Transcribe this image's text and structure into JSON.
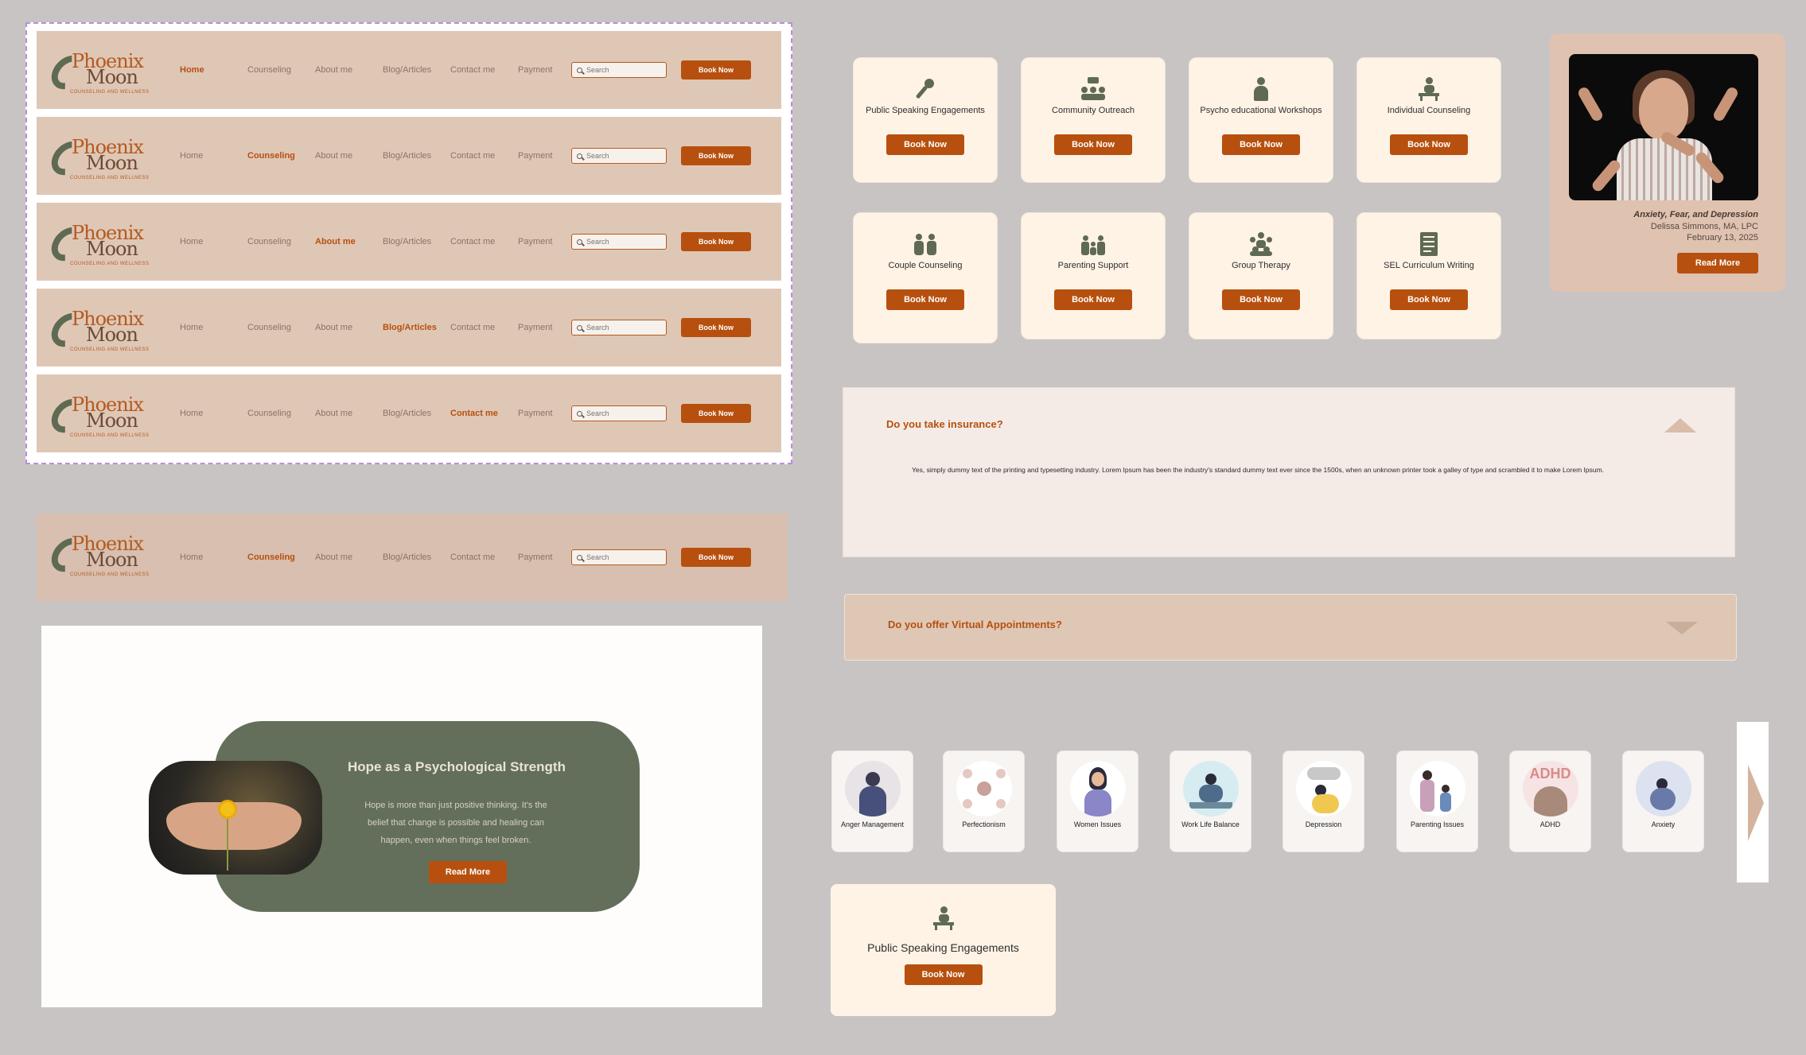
{
  "nav": {
    "logo_text_top": "Phoenix",
    "logo_text_bottom": "Moon",
    "logo_tagline": "COUNSELING AND WELLNESS",
    "links": [
      "Home",
      "Counseling",
      "About me",
      "Blog/Articles",
      "Contact me",
      "Payment"
    ],
    "search_placeholder": "Search",
    "book_label": "Book Now",
    "variants_active": [
      "Home",
      "Counseling",
      "About me",
      "Blog/Articles",
      "Contact me"
    ],
    "standalone_active": "Counseling"
  },
  "hope": {
    "title": "Hope as a Psychological Strength",
    "text": "Hope is more than just positive thinking. It's the belief that change is possible and healing can happen, even when things feel broken.",
    "button": "Read More"
  },
  "services": [
    {
      "label": "Public Speaking Engagements",
      "icon": "microphone-icon",
      "button": "Book Now"
    },
    {
      "label": "Community Outreach",
      "icon": "community-icon",
      "button": "Book Now"
    },
    {
      "label": "Psycho educational Workshops",
      "icon": "presenter-icon",
      "button": "Book Now"
    },
    {
      "label": "Individual Counseling",
      "icon": "individual-icon",
      "button": "Book Now"
    },
    {
      "label": "Couple Counseling",
      "icon": "couple-icon",
      "button": "Book Now"
    },
    {
      "label": "Parenting Support",
      "icon": "parenting-icon",
      "button": "Book Now"
    },
    {
      "label": "Group Therapy",
      "icon": "group-icon",
      "button": "Book Now"
    },
    {
      "label": "SEL Curriculum Writing",
      "icon": "document-icon",
      "button": "Book Now"
    }
  ],
  "article": {
    "title": "Anxiety, Fear, and Depression",
    "author": "Delissa Simmons, MA, LPC",
    "date": "February 13, 2025",
    "button": "Read More"
  },
  "faq": [
    {
      "question": "Do you take insurance?",
      "answer": "Yes, simply dummy text of the printing and typesetting industry. Lorem Ipsum has been the industry's standard dummy text ever since the 1500s, when an unknown printer took a galley of type and scrambled it to make Lorem Ipsum.",
      "expanded": true
    },
    {
      "question": "Do you offer Virtual Appointments?",
      "answer": "",
      "expanded": false
    }
  ],
  "topics": [
    {
      "label": "Anger Management"
    },
    {
      "label": "Perfectionism"
    },
    {
      "label": "Women Issues"
    },
    {
      "label": "Work Life Balance"
    },
    {
      "label": "Depression"
    },
    {
      "label": "Parenting Issues"
    },
    {
      "label": "ADHD"
    },
    {
      "label": "Anxiety"
    }
  ],
  "topic_badge_text": "ADHD",
  "service_big": {
    "label": "Public Speaking Engagements",
    "button": "Book Now"
  },
  "colors": {
    "accent": "#b7500e",
    "nav_bg": "#dfc7b6",
    "green": "#636f5b",
    "card_bg": "#fff3e6",
    "background": "#c8c4c4"
  }
}
